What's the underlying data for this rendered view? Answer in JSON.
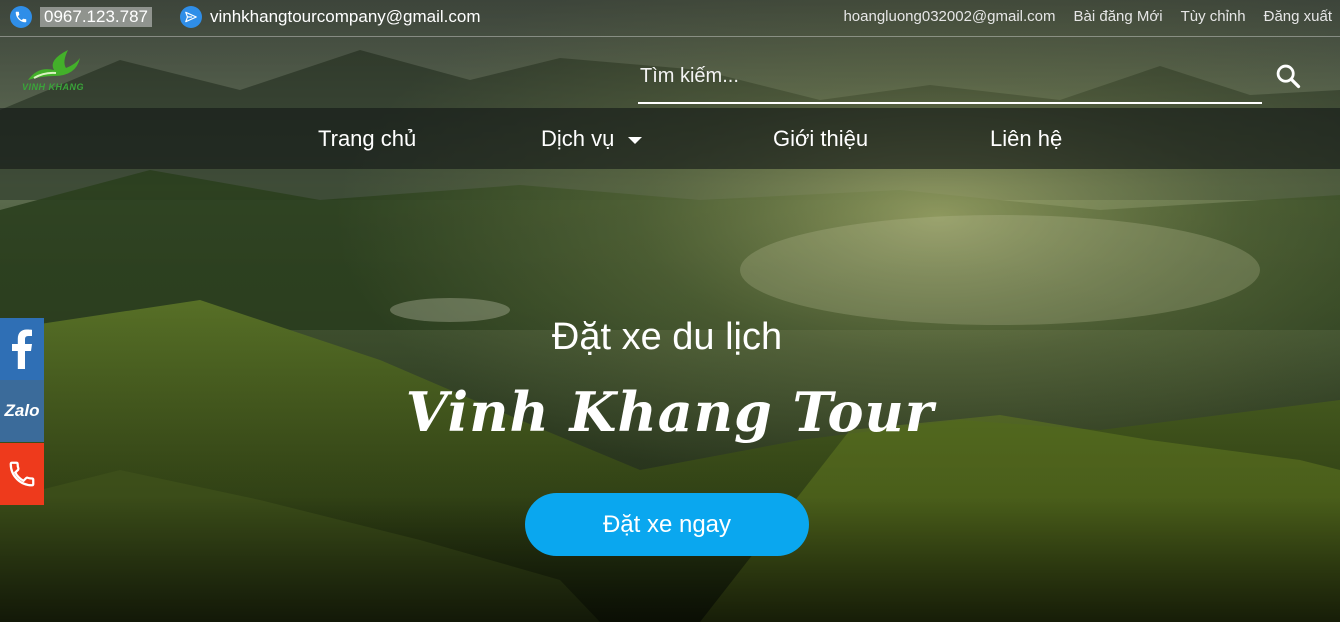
{
  "topbar": {
    "phone": "0967.123.787",
    "email": "vinhkhangtourcompany@gmail.com",
    "account_email": "hoangluong032002@gmail.com",
    "new_post": "Bài đăng Mới",
    "customize": "Tùy chỉnh",
    "logout": "Đăng xuất"
  },
  "header": {
    "logo_text": "VINH KHANG",
    "search_placeholder": "Tìm kiếm..."
  },
  "nav": {
    "items": [
      "Trang chủ",
      "Dịch vụ",
      "Giới thiệu",
      "Liên hệ"
    ]
  },
  "hero": {
    "subtitle": "Đặt xe du lịch",
    "title": "Vinh Khang Tour",
    "cta": "Đặt xe ngay"
  },
  "social": {
    "zalo": "Zalo"
  },
  "colors": {
    "cta": "#0aa7ef",
    "facebook": "#2f6fb5",
    "zalo": "#3b6b9a",
    "phone": "#ee3a1c"
  }
}
